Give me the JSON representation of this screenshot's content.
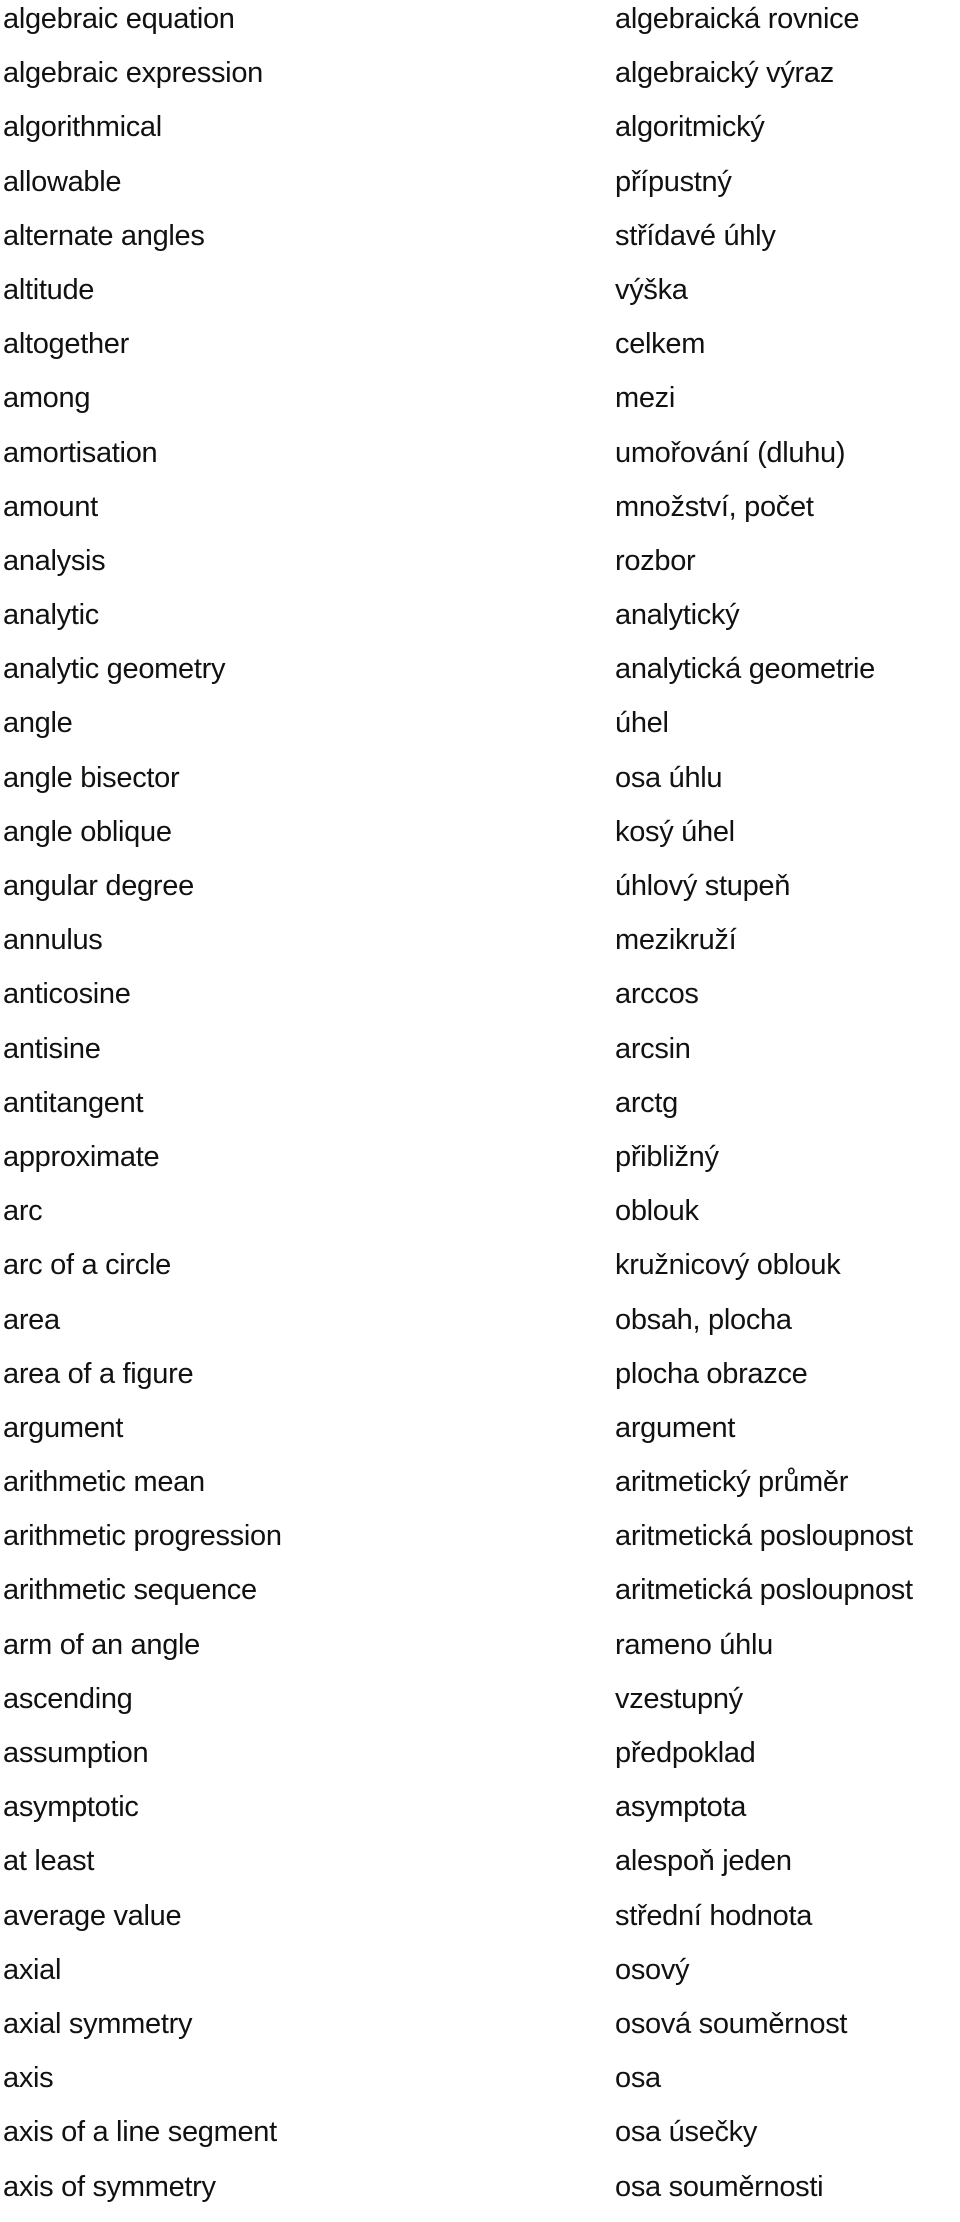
{
  "glossary": {
    "entries": [
      {
        "en": "algebraic equation",
        "cs": "algebraická rovnice"
      },
      {
        "en": "algebraic expression",
        "cs": "algebraický výraz"
      },
      {
        "en": "algorithmical",
        "cs": "algoritmický"
      },
      {
        "en": "allowable",
        "cs": "přípustný"
      },
      {
        "en": "alternate angles",
        "cs": "střídavé úhly"
      },
      {
        "en": "altitude",
        "cs": "výška"
      },
      {
        "en": "altogether",
        "cs": "celkem"
      },
      {
        "en": "among",
        "cs": "mezi"
      },
      {
        "en": "amortisation",
        "cs": "umořování (dluhu)"
      },
      {
        "en": "amount",
        "cs": "množství, počet"
      },
      {
        "en": "analysis",
        "cs": "rozbor"
      },
      {
        "en": "analytic",
        "cs": "analytický"
      },
      {
        "en": "analytic geometry",
        "cs": "analytická geometrie"
      },
      {
        "en": "angle",
        "cs": "úhel"
      },
      {
        "en": "angle bisector",
        "cs": "osa úhlu"
      },
      {
        "en": "angle oblique",
        "cs": "kosý úhel"
      },
      {
        "en": "angular degree",
        "cs": "úhlový stupeň"
      },
      {
        "en": "annulus",
        "cs": "mezikruží"
      },
      {
        "en": "anticosine",
        "cs": "arccos"
      },
      {
        "en": "antisine",
        "cs": "arcsin"
      },
      {
        "en": "antitangent",
        "cs": "arctg"
      },
      {
        "en": "approximate",
        "cs": "přibližný"
      },
      {
        "en": "arc",
        "cs": "oblouk"
      },
      {
        "en": "arc of a circle",
        "cs": "kružnicový oblouk"
      },
      {
        "en": "area",
        "cs": "obsah, plocha"
      },
      {
        "en": "area of a figure",
        "cs": "plocha obrazce"
      },
      {
        "en": "argument",
        "cs": "argument"
      },
      {
        "en": "arithmetic mean",
        "cs": "aritmetický průměr"
      },
      {
        "en": "arithmetic progression",
        "cs": "aritmetická posloupnost"
      },
      {
        "en": "arithmetic sequence",
        "cs": "aritmetická posloupnost"
      },
      {
        "en": "arm of an angle",
        "cs": "rameno úhlu"
      },
      {
        "en": "ascending",
        "cs": "vzestupný"
      },
      {
        "en": "assumption",
        "cs": "předpoklad"
      },
      {
        "en": "asymptotic",
        "cs": "asymptota"
      },
      {
        "en": "at least",
        "cs": "alespoň jeden"
      },
      {
        "en": "average value",
        "cs": "střední hodnota"
      },
      {
        "en": "axial",
        "cs": "osový"
      },
      {
        "en": "axial symmetry",
        "cs": "osová souměrnost"
      },
      {
        "en": "axis",
        "cs": "osa"
      },
      {
        "en": "axis of a line segment",
        "cs": "osa úsečky"
      },
      {
        "en": "axis of symmetry",
        "cs": "osa souměrnosti"
      }
    ]
  }
}
